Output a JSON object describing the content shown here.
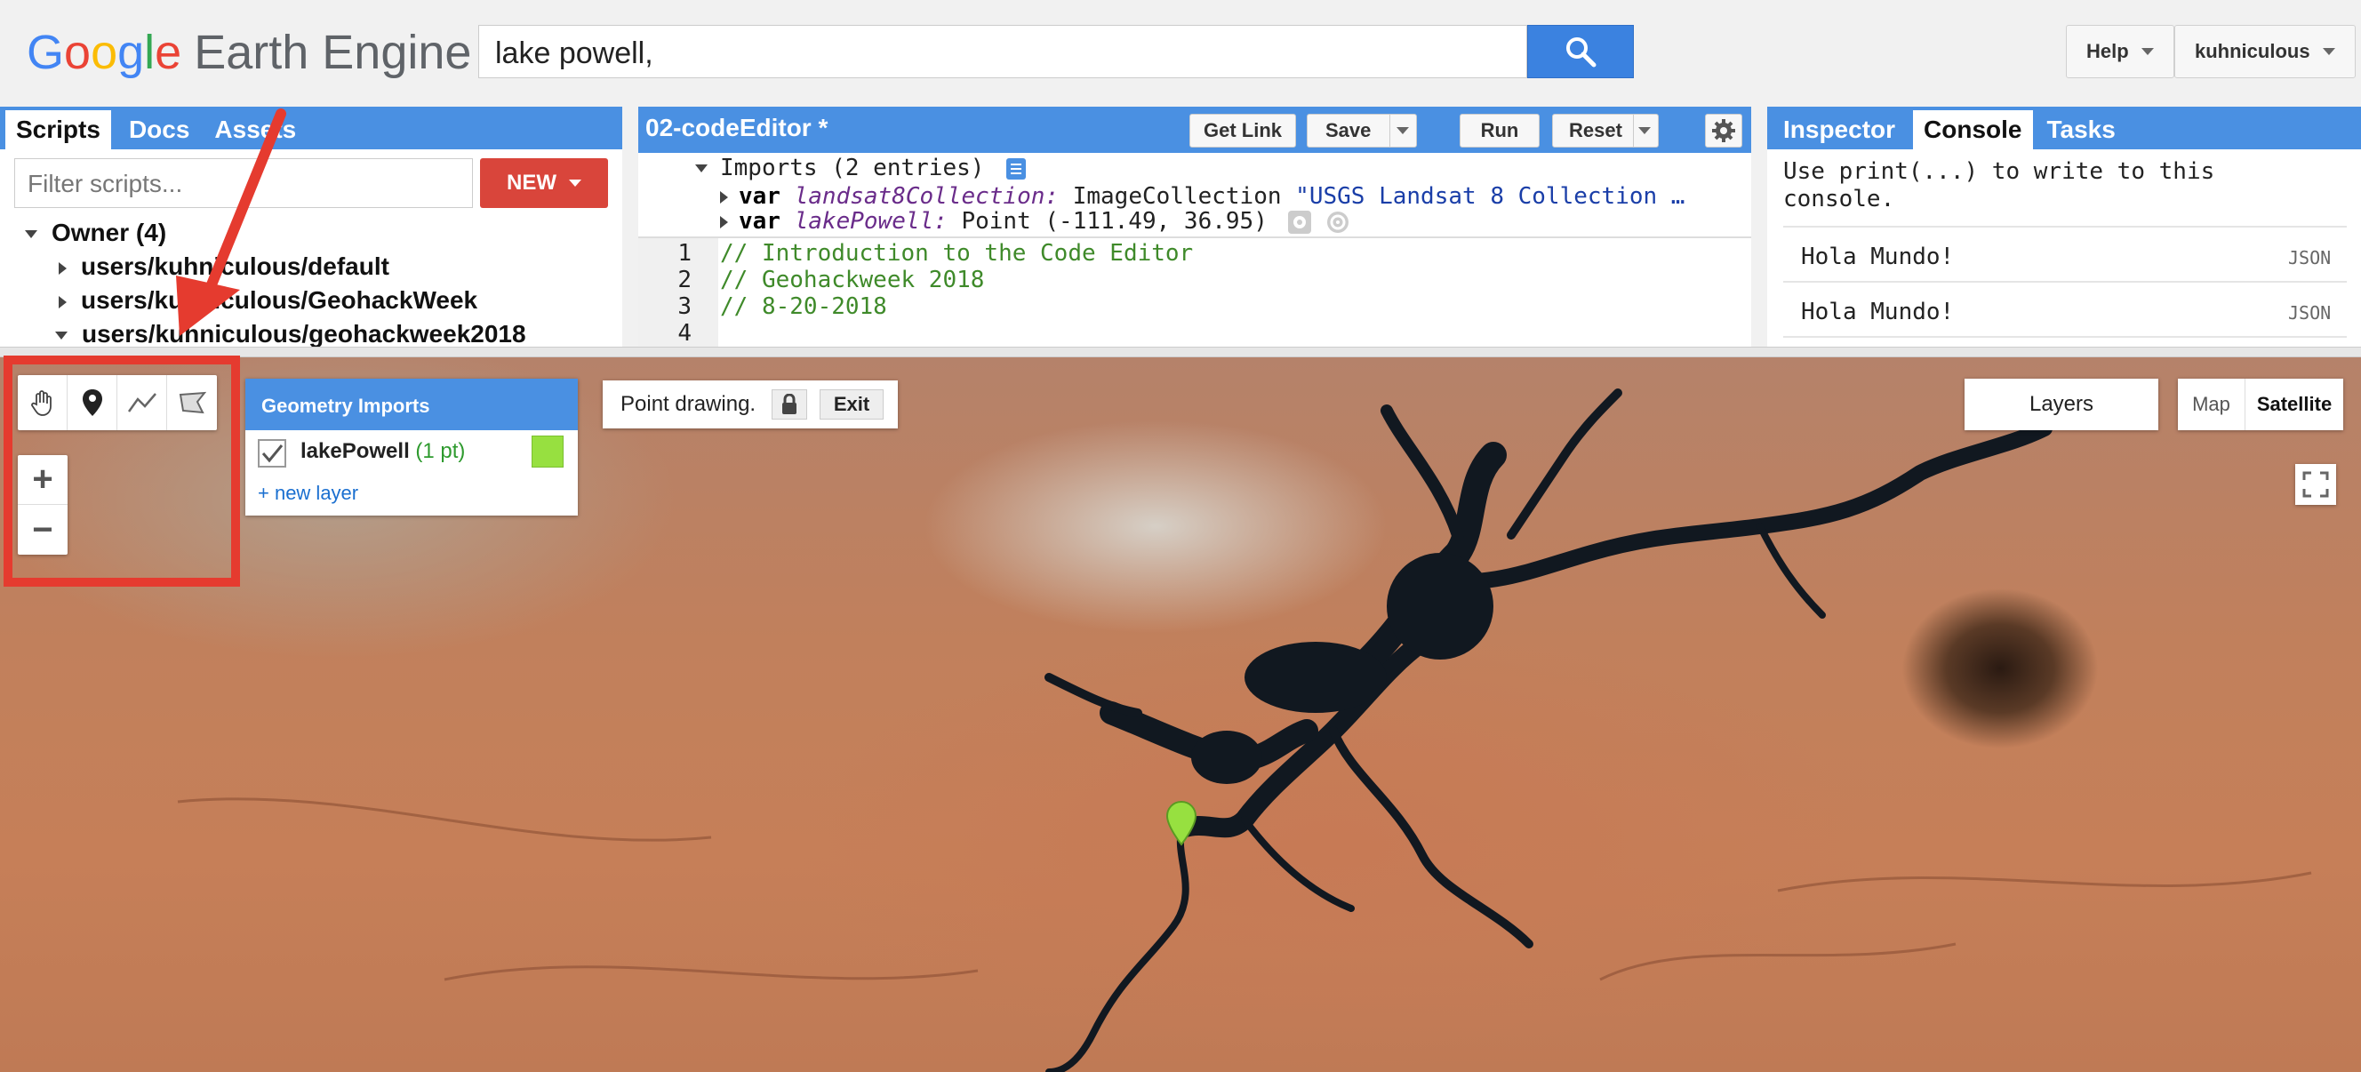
{
  "header": {
    "logo_google": "Google",
    "logo_rest": "Earth Engine",
    "search_value": "lake powell,",
    "help_label": "Help",
    "user_label": "kuhniculous"
  },
  "left_panel": {
    "tabs": [
      "Scripts",
      "Docs",
      "Assets"
    ],
    "filter_placeholder": "Filter scripts...",
    "new_label": "NEW",
    "tree": {
      "owner": "Owner",
      "owner_count": "(4)",
      "items": [
        "users/kuhniculous/default",
        "users/kuhniculous/GeohackWeek",
        "users/kuhniculous/geohackweek2018"
      ]
    }
  },
  "editor": {
    "title": "02-codeEditor *",
    "buttons": {
      "get_link": "Get Link",
      "save": "Save",
      "run": "Run",
      "reset": "Reset"
    },
    "imports_header": "Imports (2 entries)",
    "import1": {
      "kw": "var",
      "name": "landsat8Collection:",
      "type": "ImageCollection",
      "value": "\"USGS Landsat 8 Collection …"
    },
    "import2": {
      "kw": "var",
      "name": "lakePowell:",
      "value": "Point (-111.49, 36.95)"
    },
    "lines": [
      {
        "n": "1",
        "text": "// Introduction to the Code Editor"
      },
      {
        "n": "2",
        "text": "// Geohackweek 2018"
      },
      {
        "n": "3",
        "text": "// 8-20-2018"
      },
      {
        "n": "4",
        "text": ""
      }
    ]
  },
  "right_panel": {
    "tabs": [
      "Inspector",
      "Console",
      "Tasks"
    ],
    "intro": "Use print(...) to write to this console.",
    "entries": [
      {
        "text": "Hola Mundo!",
        "tag": "JSON"
      },
      {
        "text": "Hola Mundo!",
        "tag": "JSON"
      }
    ]
  },
  "map": {
    "geometry_imports_title": "Geometry Imports",
    "layer_name": "lakePowell",
    "layer_count": "(1 pt)",
    "new_layer": "+ new layer",
    "point_drawing": "Point drawing.",
    "exit_label": "Exit",
    "layers_label": "Layers",
    "map_label": "Map",
    "satellite_label": "Satellite",
    "zoom_in": "+",
    "zoom_out": "−"
  },
  "colors": {
    "accent_blue": "#4a90e2",
    "new_red": "#d9453b",
    "annotation_red": "#e53b2f",
    "layer_green": "#97e040"
  }
}
